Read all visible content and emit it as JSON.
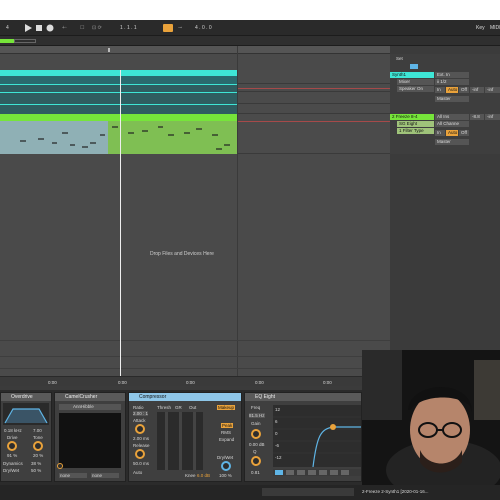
{
  "transport": {
    "tempo_digit": "4",
    "position": "1 . 1 . 1",
    "loop_length": "4 . 0 . 0",
    "key": "Key",
    "midi": "MIDI"
  },
  "mixer": {
    "header": "Set",
    "track1": {
      "name": "Synth1",
      "input": "Ext. In",
      "channel": "ii 1/2",
      "monitor_label": "Mixer",
      "device": "Speaker On",
      "in": "In",
      "auto": "Auto",
      "off": "Off",
      "value1": "-inf",
      "value2": "-inf",
      "master": "Master"
    },
    "track2": {
      "name": "2 Freeze 8-4",
      "input": "All Ins",
      "device": "SG Eight",
      "channel": "All Channe",
      "filter": "1 Filter Type",
      "in": "In",
      "auto": "Auto",
      "off": "Off",
      "value1": "-8.8",
      "value2": "-inf",
      "master": "Master"
    }
  },
  "drop_hint": "Drop Files and Devices Here",
  "bottom_ruler": [
    "0:00",
    "0:00",
    "0:00",
    "0:00",
    "0:00"
  ],
  "devices": {
    "overdrive": {
      "title": "Overdrive",
      "freq": "0.18 kHz",
      "width": "7.00",
      "drive_label": "Drive",
      "tone_label": "Tone",
      "drive": "91 %",
      "tone": "20 %",
      "dynamics_label": "Dynamics",
      "drywet_label": "Dry/Wet",
      "dynamics": "38 %",
      "drywet": "50 %"
    },
    "camel": {
      "title": "CamelCrusher",
      "preset": "AnnHibble",
      "slot1": "none",
      "slot2": "none"
    },
    "compressor": {
      "title": "Compressor",
      "ratio_label": "Ratio",
      "ratio": "2.00 : 1",
      "attack_label": "Attack",
      "attack": "2.00 ms",
      "release_label": "Release",
      "release": "50.0 ms",
      "auto_label": "Auto",
      "thresh_label": "Thresh",
      "gr_label": "GR",
      "out_label": "Out",
      "makeup": "Makeup",
      "peak": "Peak",
      "rms": "RMS",
      "expand": "Expand",
      "knee_label": "Knee",
      "knee": "6.0 dB",
      "drywet_label": "Dry/Wet",
      "drywet": "100 %"
    },
    "eq": {
      "title": "EQ Eight",
      "freq_label": "Freq",
      "freq": "81.5 Hz",
      "gain_label": "Gain",
      "gain": "0.00 dB",
      "q_label": "Q",
      "q": "0.81",
      "scale": [
        "12",
        "6",
        "0",
        "-6",
        "-12"
      ]
    }
  },
  "status": {
    "clip": "2-Freeze 2-Synth1 [2020-01-16..."
  },
  "colors": {
    "cyan": "#3ee6d6",
    "green": "#76e53a",
    "orange": "#e9a23b",
    "blue": "#5fb5e6"
  }
}
